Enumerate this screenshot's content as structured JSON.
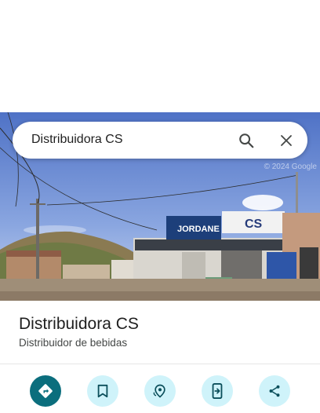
{
  "search": {
    "query": "Distribuidora CS"
  },
  "photo": {
    "watermark": "© 2024 Google",
    "storefront_sign": "JORDANE",
    "sign_2": "CS"
  },
  "place": {
    "name": "Distribuidora CS",
    "category": "Distribuidor de bebidas"
  },
  "actions": [
    {
      "name": "directions",
      "icon": "directions-icon"
    },
    {
      "name": "save",
      "icon": "bookmark-icon"
    },
    {
      "name": "nearby",
      "icon": "nearby-icon"
    },
    {
      "name": "send-to-phone",
      "icon": "send-to-phone-icon"
    },
    {
      "name": "share",
      "icon": "share-icon"
    }
  ],
  "colors": {
    "accent": "#0b6e7d",
    "action_bg": "#cff3fa",
    "text_primary": "#1f1f1f",
    "text_secondary": "#444746"
  }
}
